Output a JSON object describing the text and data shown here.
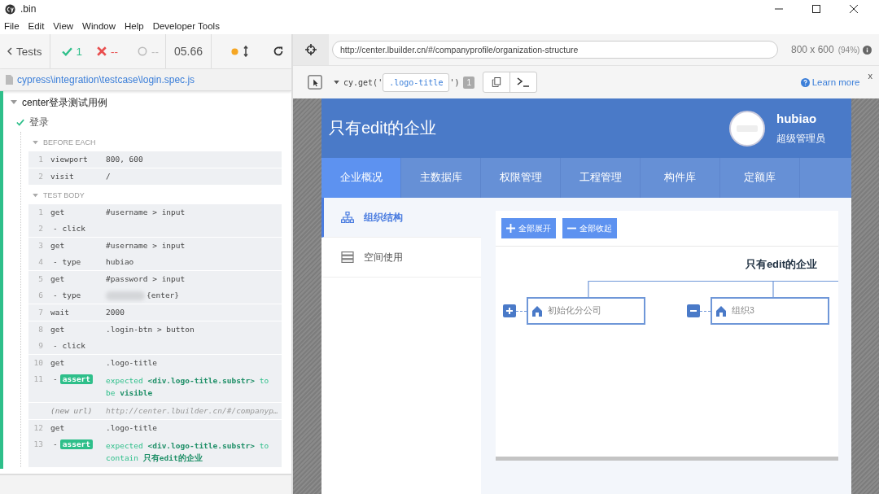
{
  "window": {
    "title": ".bin"
  },
  "menu": [
    "File",
    "Edit",
    "View",
    "Window",
    "Help",
    "Developer Tools"
  ],
  "runner": {
    "back": "Tests",
    "passed": "1",
    "failed": "--",
    "pending": "--",
    "duration": "05.66",
    "spec": "cypress\\integration\\testcase\\login.spec.js"
  },
  "suite": {
    "title": "center登录测试用例",
    "expanded": true,
    "test": {
      "title": "登录",
      "passed": true
    },
    "hooks": [
      {
        "label": "BEFORE EACH",
        "groups": [
          [
            {
              "kind": "command",
              "num": "1",
              "name": "viewport",
              "message": "800, 600"
            }
          ],
          [
            {
              "kind": "command",
              "num": "2",
              "name": "visit",
              "message": "/"
            }
          ]
        ]
      },
      {
        "label": "TEST BODY",
        "groups": [
          [
            {
              "kind": "command",
              "num": "1",
              "name": "get",
              "message": "#username > input"
            },
            {
              "kind": "child",
              "num": "2",
              "name": "- click"
            }
          ],
          [
            {
              "kind": "command",
              "num": "3",
              "name": "get",
              "message": "#username > input"
            },
            {
              "kind": "child",
              "num": "4",
              "name": "- type",
              "message": "hubiao"
            }
          ],
          [
            {
              "kind": "command",
              "num": "5",
              "name": "get",
              "message": "#password > input"
            },
            {
              "kind": "child",
              "num": "6",
              "name": "- type",
              "message": "{enter}",
              "blurred": true
            }
          ],
          [
            {
              "kind": "command",
              "num": "7",
              "name": "wait",
              "message": "2000"
            }
          ],
          [
            {
              "kind": "command",
              "num": "8",
              "name": "get",
              "message": ".login-btn > button"
            },
            {
              "kind": "child",
              "num": "9",
              "name": "- click"
            }
          ],
          [
            {
              "kind": "command",
              "num": "10",
              "name": "get",
              "message": ".logo-title"
            },
            {
              "kind": "assert",
              "num": "11",
              "dash": "-",
              "name": "assert",
              "message": "expected **<div.logo-title.substr>** to be **visible**"
            }
          ],
          [
            {
              "kind": "event",
              "name": "(new url)",
              "message": "http://center.lbuilder.cn/#/companyp…"
            }
          ],
          [
            {
              "kind": "command",
              "num": "12",
              "name": "get",
              "message": ".logo-title"
            },
            {
              "kind": "assert",
              "num": "13",
              "dash": "-",
              "name": "assert",
              "message": "expected **<div.logo-title.substr>** to contain **只有edit的企业**"
            }
          ]
        ]
      }
    ]
  },
  "browser": {
    "url": "http://center.lbuilder.cn/#/companyprofile/organization-structure",
    "size": "800 x 600",
    "zoom": "(94%)",
    "selector": {
      "prefix": "cy.get('",
      "value": ".logo-title",
      "suffix": "')",
      "count": "1",
      "help": "Learn more",
      "close": "x"
    }
  },
  "app": {
    "title": "只有edit的企业",
    "user": "hubiao",
    "role": "超级管理员",
    "tabs": [
      {
        "label": "企业概况",
        "selected": true
      },
      {
        "label": "主数据库",
        "selected": false
      },
      {
        "label": "权限管理",
        "selected": false
      },
      {
        "label": "工程管理",
        "selected": false
      },
      {
        "label": "构件库",
        "selected": false
      },
      {
        "label": "定额库",
        "selected": false
      }
    ],
    "sidebar": [
      {
        "label": "组织结构",
        "selected": true,
        "kind": "tree"
      },
      {
        "label": "空间使用",
        "selected": false,
        "kind": "storage"
      }
    ],
    "buttons": [
      {
        "label": "全部展开",
        "kind": "expand"
      },
      {
        "label": "全部收起",
        "kind": "collapse"
      }
    ],
    "org": {
      "root": "只有edit的企业",
      "children": [
        {
          "name": "初始化分公司",
          "expanded": false
        },
        {
          "name": "组织3",
          "expanded": true
        }
      ]
    }
  }
}
